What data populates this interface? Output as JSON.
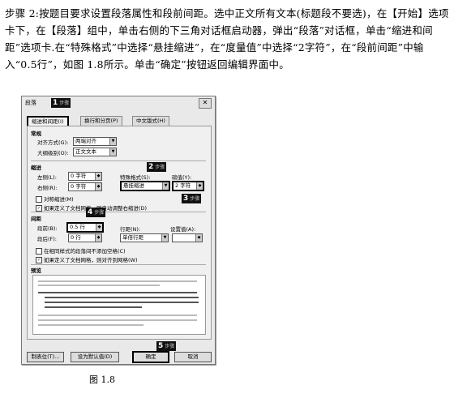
{
  "instruction": "步骤 2:按题目要求设置段落属性和段前间距。选中正文所有文本(标题段不要选)，在【开始】选项卡下，在【段落】组中，单击右侧的下三角对话框启动器，弹出“段落”对话框，单击“缩进和间距”选项卡.在“特殊格式”中选择“悬挂缩进”，在“度量值”中选择“2字符”，在“段前间距”中输入“0.5行”，如图 1.8所示。单击“确定”按钮返回编辑界面中。",
  "dialog": {
    "title": "段落",
    "tabs": [
      "缩进和间距(I)",
      "换行和分页(P)",
      "中文版式(H)"
    ],
    "general": {
      "heading": "常规",
      "align_label": "对齐方式(G):",
      "align_value": "两端对齐",
      "outline_label": "大纲级别(O):",
      "outline_value": "正文文本"
    },
    "indent": {
      "heading": "缩进",
      "left_label": "左侧(L):",
      "left_value": "0 字符",
      "right_label": "右侧(R):",
      "right_value": "0 字符",
      "special_label": "特殊格式(S):",
      "special_value": "悬挂缩进",
      "measure_label": "磅值(Y):",
      "measure_value": "2 字符",
      "mirror": "对称缩进(M)",
      "grid_adjust": "如果定义了文档网格，则自动调整右缩进(D)"
    },
    "spacing": {
      "heading": "间距",
      "before_label": "段前(B):",
      "before_value": "0.5 行",
      "after_label": "段后(F):",
      "after_value": "0 行",
      "line_label": "行距(N):",
      "line_value": "单倍行距",
      "at_label": "设置值(A):",
      "no_space": "在相同样式的段落间不添加空格(C)",
      "snap_grid": "如果定义了文档网格，则对齐到网格(W)"
    },
    "preview_heading": "预览",
    "buttons": {
      "tabs": "制表位(T)...",
      "default": "设为默认值(D)",
      "ok": "确定",
      "cancel": "取消"
    },
    "markers": [
      "1",
      "2",
      "3",
      "4",
      "5"
    ],
    "marker_sub": "步骤"
  },
  "caption": "图 1.8"
}
